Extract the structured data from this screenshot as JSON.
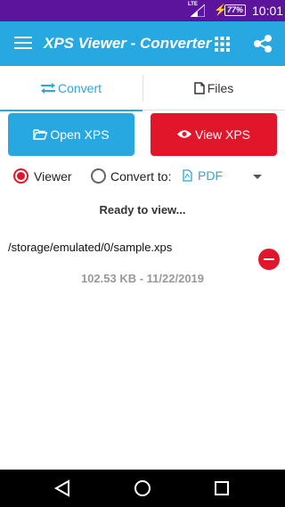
{
  "status_bar": {
    "network": "LTE",
    "battery": "77%",
    "time": "10:01"
  },
  "app_bar": {
    "title": "XPS Viewer - Converter",
    "icons": [
      "menu-icon",
      "grid-icon",
      "share-icon"
    ]
  },
  "tabs": [
    {
      "label": "Convert",
      "icon": "swap-arrows-icon",
      "selected": true
    },
    {
      "label": "Files",
      "icon": "file-icon",
      "selected": false
    }
  ],
  "buttons": {
    "open_label": "Open XPS",
    "view_label": "View XPS"
  },
  "mode": {
    "viewer_label": "Viewer",
    "convert_label": "Convert to:",
    "selected": "Viewer",
    "format_selected": "PDF"
  },
  "status_text": "Ready to view...",
  "file": {
    "path": "/storage/emulated/0/sample.xps",
    "meta": "102.53 KB - 11/22/2019"
  },
  "colors": {
    "status_bar": "#5d149c",
    "primary": "#27a8e0",
    "accent": "#e1162b"
  }
}
